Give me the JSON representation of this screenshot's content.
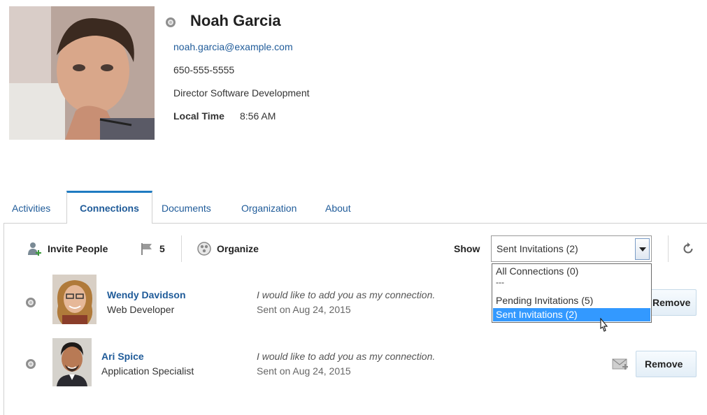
{
  "profile": {
    "name": "Noah Garcia",
    "email": "noah.garcia@example.com",
    "phone": "650-555-5555",
    "title": "Director Software Development",
    "local_time_label": "Local Time",
    "local_time_value": "8:56 AM"
  },
  "tabs": [
    {
      "label": "Activities"
    },
    {
      "label": "Connections",
      "active": true
    },
    {
      "label": "Documents"
    },
    {
      "label": "Organization"
    },
    {
      "label": "About"
    }
  ],
  "toolbar": {
    "invite_label": "Invite People",
    "flag_count": "5",
    "organize_label": "Organize",
    "show_label": "Show",
    "show_selected": "Sent Invitations (2)"
  },
  "dropdown": {
    "options": [
      "All Connections (0)",
      "---",
      "Pending Invitations (5)",
      "Sent Invitations (2)"
    ]
  },
  "connections": [
    {
      "name": "Wendy Davidson",
      "role": "Web Developer",
      "message": "I would like to add you as my connection.",
      "sent": "Sent on Aug 24, 2015",
      "action": "Remove"
    },
    {
      "name": "Ari Spice",
      "role": "Application Specialist",
      "message": "I would like to add you as my connection.",
      "sent": "Sent on Aug 24, 2015",
      "action": "Remove"
    }
  ],
  "colors": {
    "link": "#1f5b99",
    "accent": "#1f7bc1",
    "highlight": "#3399ff"
  }
}
